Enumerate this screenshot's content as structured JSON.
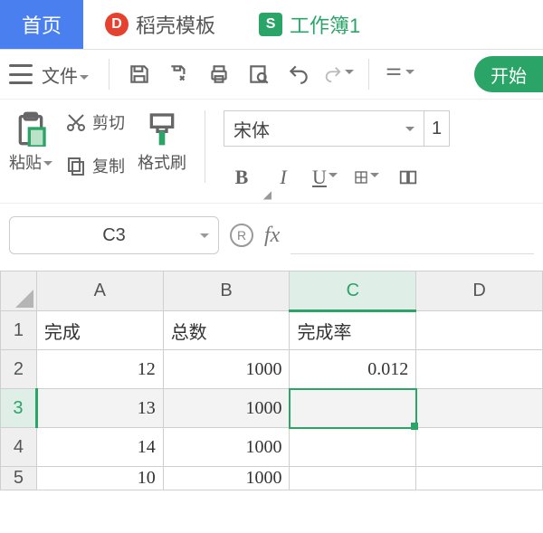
{
  "tabs": {
    "home": "首页",
    "template_icon": "D",
    "template": "稻壳模板",
    "workbook_icon": "S",
    "workbook": "工作簿1"
  },
  "toolbar": {
    "file": "文件",
    "start": "开始"
  },
  "ribbon": {
    "paste": "粘贴",
    "cut": "剪切",
    "copy": "复制",
    "format_painter": "格式刷",
    "font_name": "宋体",
    "font_size": "1",
    "bold": "B",
    "italic": "I",
    "underline": "U"
  },
  "namebox": "C3",
  "columns": [
    "A",
    "B",
    "C",
    "D"
  ],
  "rows": [
    "1",
    "2",
    "3",
    "4",
    "5"
  ],
  "header_row": {
    "A": "完成",
    "B": "总数",
    "C": "完成率",
    "D": ""
  },
  "data": {
    "r2": {
      "A": "12",
      "B": "1000",
      "C": "0.012",
      "D": ""
    },
    "r3": {
      "A": "13",
      "B": "1000",
      "C": "",
      "D": ""
    },
    "r4": {
      "A": "14",
      "B": "1000",
      "C": "",
      "D": ""
    },
    "r5": {
      "A": "10",
      "B": "1000",
      "C": "",
      "D": ""
    }
  }
}
